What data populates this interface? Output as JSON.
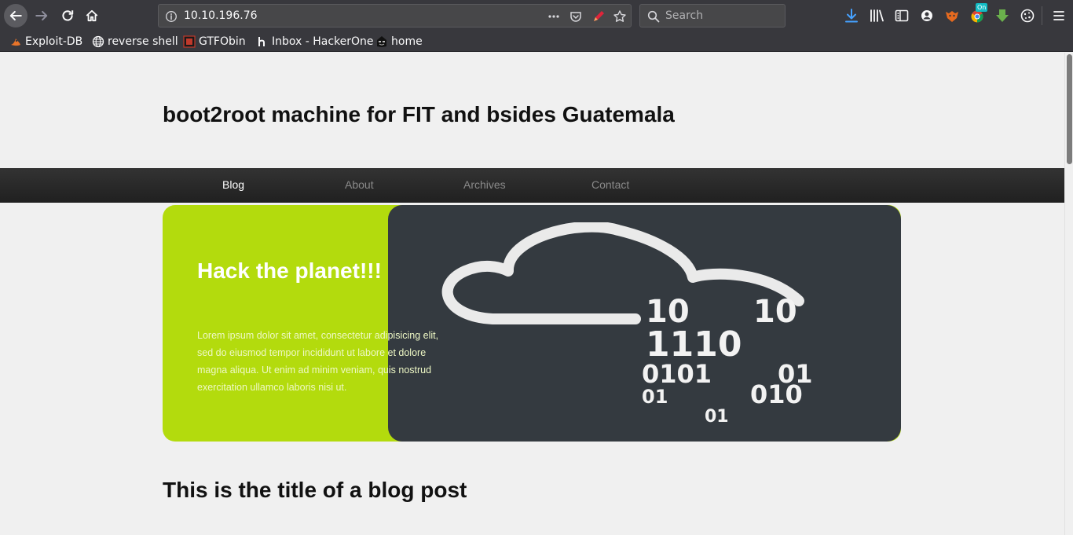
{
  "browser": {
    "url": "10.10.196.76",
    "search_placeholder": "Search",
    "toolbar_badge": "On"
  },
  "bookmarks": [
    {
      "label": "Exploit-DB",
      "icon": "exploit-db-icon"
    },
    {
      "label": "reverse shell",
      "icon": "globe-icon"
    },
    {
      "label": "GTFObin",
      "icon": "gtfobins-icon"
    },
    {
      "label": "Inbox - HackerOne",
      "icon": "hackerone-icon"
    },
    {
      "label": "home",
      "icon": "hacker-mask-icon"
    }
  ],
  "site": {
    "title": "boot2root machine for FIT and bsides Guatemala",
    "nav": [
      "Blog",
      "About",
      "Archives",
      "Contact"
    ],
    "active_nav": "Blog"
  },
  "hero": {
    "heading": "Hack the planet!!!",
    "text": "Lorem ipsum dolor sit amet, consectetur adipisicing elit, sed do eiusmod tempor incididunt ut labore et dolore magna aliqua. Ut enim ad minim veniam, quis nostrud exercitation ullamco laboris nisi ut.",
    "binary_lines": [
      "10",
      "10",
      "1110",
      "0101",
      "01",
      "01",
      "010",
      "01"
    ],
    "accent_color": "#b3db0d",
    "dark_color": "#343a40"
  },
  "post": {
    "title": "This is the title of a blog post"
  }
}
